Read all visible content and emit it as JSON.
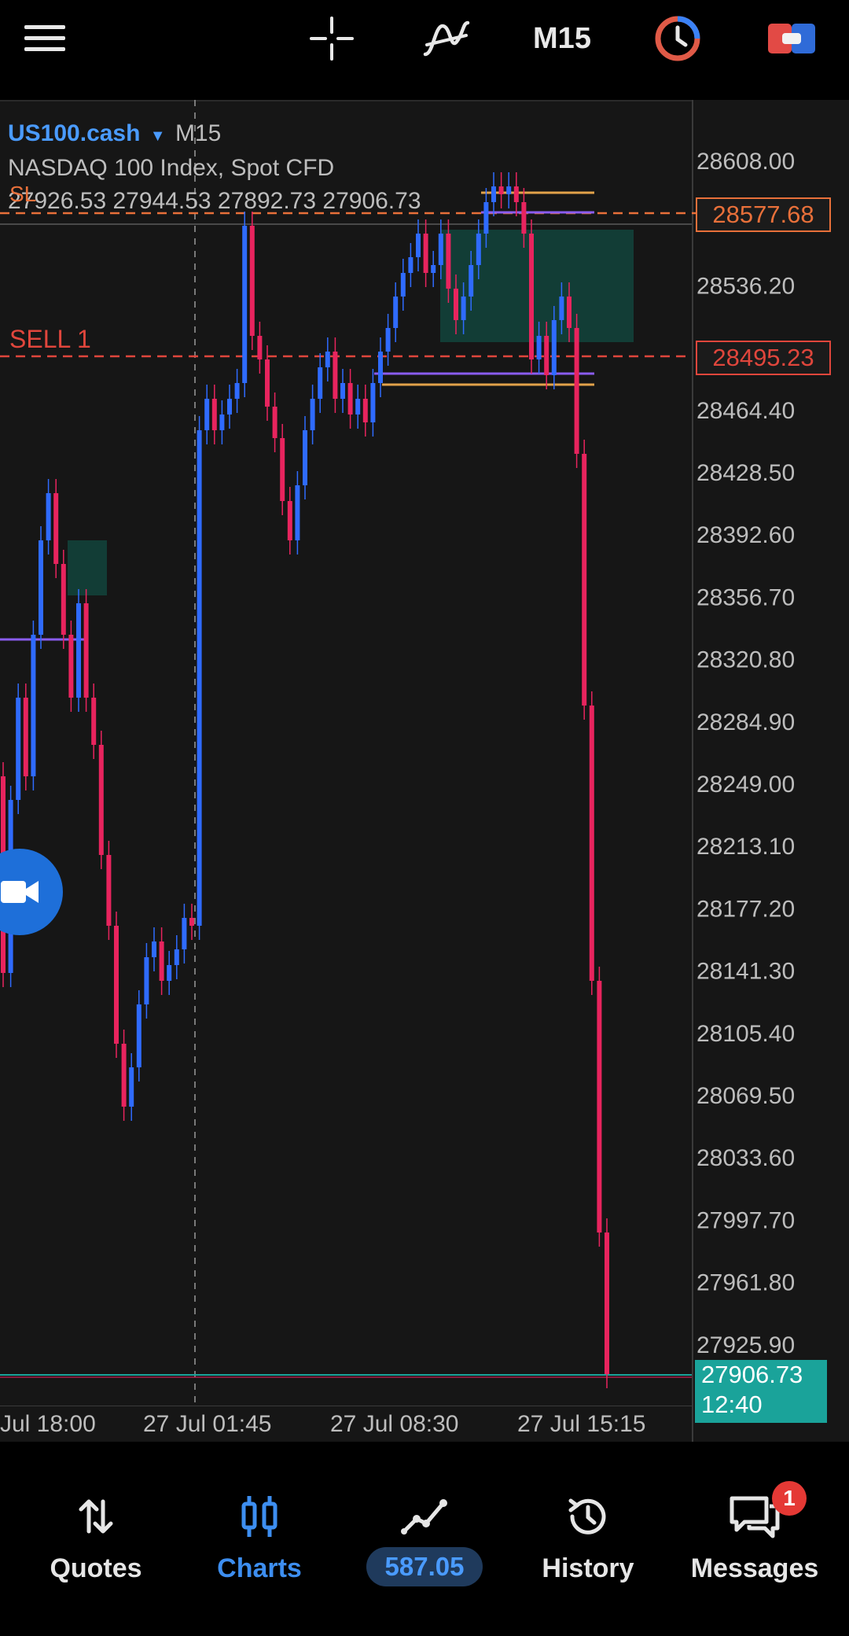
{
  "toolbar": {
    "menu_icon": "hamburger-icon",
    "crosshair_icon": "crosshair-icon",
    "indicators_icon": "indicators-icon",
    "timeframe_label": "M15",
    "clock_icon": "clock-icon",
    "trade_icon": "one-click-trade-icon"
  },
  "chart": {
    "symbol": "US100.cash",
    "timeframe": "M15",
    "description": "NASDAQ 100 Index, Spot CFD",
    "ohlc": "27926.53 27944.53 27892.73 27906.73",
    "sl_label": "SL",
    "sell_label": "SELL 1",
    "sl_price": "28577.68",
    "sell_price": "28495.23",
    "last_price": "27906.73",
    "countdown": "12:40",
    "y_ticks": [
      "28608.00",
      "28536.20",
      "28464.40",
      "28428.50",
      "28392.60",
      "28356.70",
      "28320.80",
      "28284.90",
      "28249.00",
      "28213.10",
      "28177.20",
      "28141.30",
      "28105.40",
      "28069.50",
      "28033.60",
      "27997.70",
      "27961.80",
      "27925.90"
    ],
    "x_ticks": [
      "Jul 18:00",
      "27 Jul 01:45",
      "27 Jul 08:30",
      "27 Jul 15:15"
    ],
    "colors": {
      "bull": "#2f6bff",
      "bear": "#e8245e",
      "sl": "#e8703a",
      "sell": "#e0463c",
      "last": "#1aa39a",
      "zone": "#12413a",
      "level_purple": "#8a5cf0",
      "level_orange": "#e2a24a"
    },
    "video_icon": "video-camera-icon"
  },
  "nav": {
    "items": [
      {
        "label": "Quotes",
        "icon": "up-down-arrows-icon"
      },
      {
        "label": "Charts",
        "icon": "candlesticks-icon"
      },
      {
        "label": "587.05",
        "icon": "trade-line-icon"
      },
      {
        "label": "History",
        "icon": "history-clock-icon"
      },
      {
        "label": "Messages",
        "icon": "chat-bubbles-icon"
      }
    ],
    "messages_badge": "1"
  }
}
